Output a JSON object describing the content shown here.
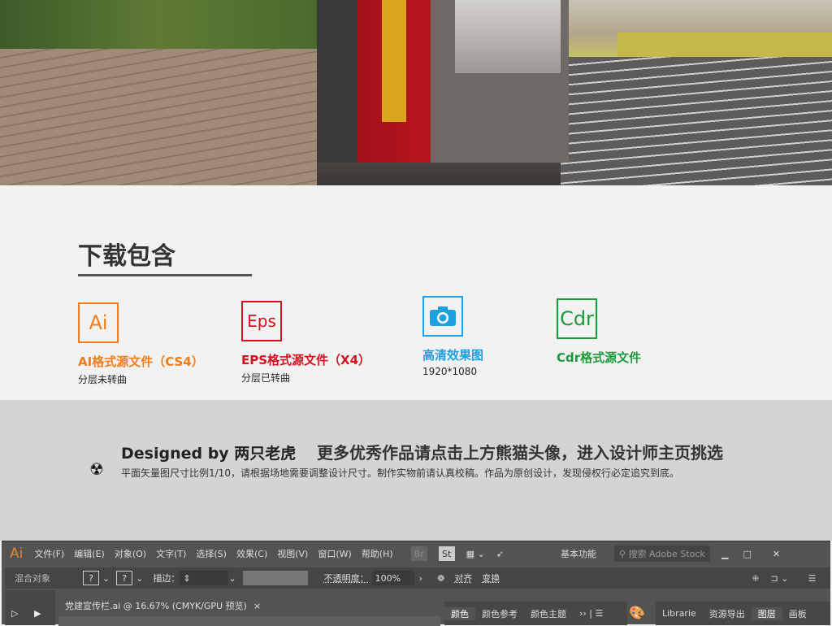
{
  "download": {
    "title": "下载包含",
    "formats": [
      {
        "icon": "Ai",
        "label": "AI格式源文件（CS4）",
        "sub": "分层未转曲",
        "color": "#f07c1a"
      },
      {
        "icon": "Eps",
        "label": "EPS格式源文件（X4）",
        "sub": "分层已转曲",
        "color": "#d7101e"
      },
      {
        "icon": "camera-icon",
        "label": "高清效果图",
        "sub": "1920*1080",
        "color": "#1fa0e0"
      },
      {
        "icon": "Cdr",
        "label": "Cdr格式源文件",
        "sub": "",
        "color": "#1b9a3b"
      }
    ]
  },
  "footer": {
    "designed": "Designed by 两只老虎",
    "more": "更多优秀作品请点击上方熊猫头像，进入设计师主页挑选",
    "note": "平面矢量图尺寸比例1/10，请根据场地需要调整设计尺寸。制作实物前请认真校稿。作品为原创设计，发现侵权行必定追究到底。"
  },
  "illustrator": {
    "logo": "Ai",
    "menu": [
      "文件(F)",
      "编辑(E)",
      "对象(O)",
      "文字(T)",
      "选择(S)",
      "效果(C)",
      "视图(V)",
      "窗口(W)",
      "帮助(H)"
    ],
    "br": "Br",
    "st": "St",
    "workspace": "基本功能",
    "search_placeholder": "搜索 Adobe Stock",
    "control": {
      "object": "混合对象",
      "q": "?",
      "stroke": "描边：",
      "opacity_label": "不透明度：",
      "opacity": "100%",
      "align": "对齐",
      "transform": "变换"
    },
    "doc_tab": "党建宣传栏.ai @ 16.67% (CMYK/GPU 预览)",
    "close": "×",
    "panel_left": [
      "颜色",
      "颜色参考",
      "颜色主题"
    ],
    "panel_right": [
      "Librarie",
      "资源导出",
      "图层",
      "画板"
    ]
  }
}
